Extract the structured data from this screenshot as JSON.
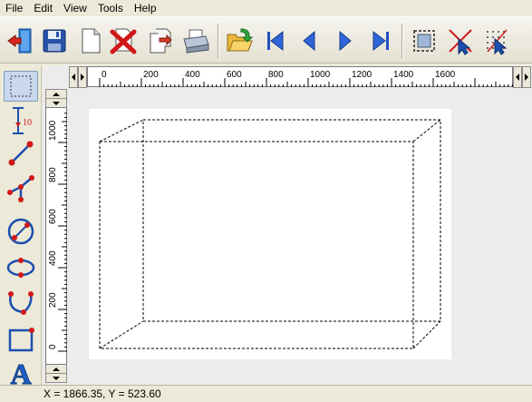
{
  "menu": {
    "items": [
      {
        "label": "File"
      },
      {
        "label": "Edit"
      },
      {
        "label": "View"
      },
      {
        "label": "Tools"
      },
      {
        "label": "Help"
      }
    ]
  },
  "toolbar": {
    "buttons": [
      {
        "name": "exit-icon"
      },
      {
        "name": "save-icon"
      },
      {
        "name": "new-document-icon"
      },
      {
        "name": "delete-icon"
      },
      {
        "name": "export-icon"
      },
      {
        "name": "print-icon"
      },
      {
        "name": "open-folder-icon"
      },
      {
        "name": "first-page-icon"
      },
      {
        "name": "previous-page-icon"
      },
      {
        "name": "next-page-icon"
      },
      {
        "name": "last-page-icon"
      },
      {
        "name": "select-box-icon"
      },
      {
        "name": "deselect-icon"
      },
      {
        "name": "snap-grid-icon"
      }
    ]
  },
  "tools": [
    {
      "name": "select-rectangle-tool"
    },
    {
      "name": "dimension-tool",
      "label": "10"
    },
    {
      "name": "line-tool"
    },
    {
      "name": "polyline-tool"
    },
    {
      "name": "circle-tool"
    },
    {
      "name": "ellipse-tool"
    },
    {
      "name": "arc-tool"
    },
    {
      "name": "rectangle-tool"
    },
    {
      "name": "text-tool",
      "label": "A"
    }
  ],
  "rulers": {
    "horizontal": [
      "0",
      "200",
      "400",
      "600",
      "800",
      "1000",
      "1200",
      "1400",
      "1600"
    ],
    "vertical": [
      "1000",
      "800",
      "600",
      "400",
      "200",
      "0"
    ]
  },
  "colors": {
    "accent_blue": "#1f4fbf",
    "tool_red": "#d01818",
    "tool_blue": "#1c4fb0"
  },
  "status": {
    "coords": "X = 1866.35, Y = 523.60"
  }
}
